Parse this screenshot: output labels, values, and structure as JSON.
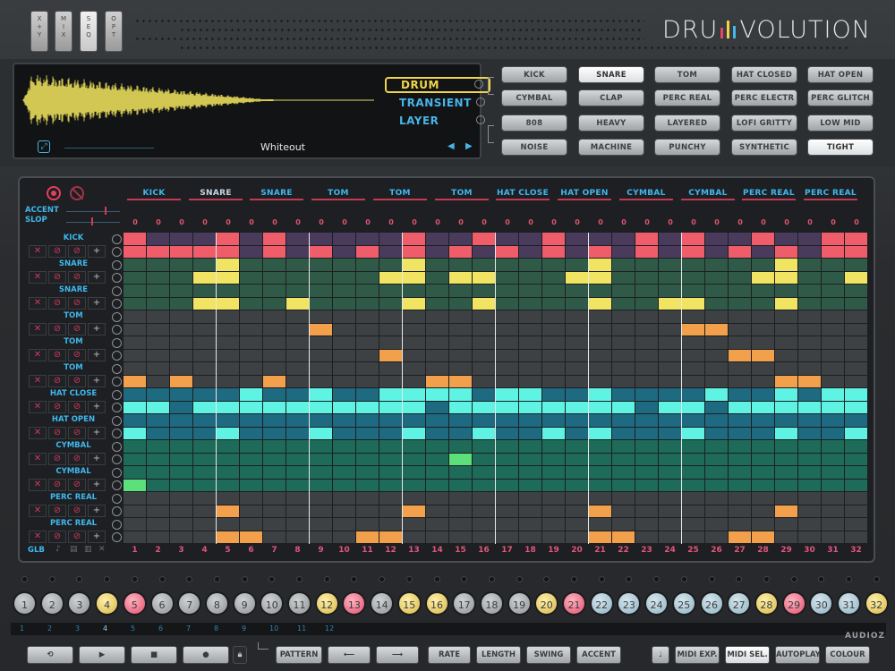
{
  "top_tabs": [
    {
      "l1": "X",
      "l2": "+",
      "l3": "Y"
    },
    {
      "l1": "M",
      "l2": "I",
      "l3": "X"
    },
    {
      "l1": "S",
      "l2": "E",
      "l3": "Q"
    },
    {
      "l1": "O",
      "l2": "P",
      "l3": "T"
    }
  ],
  "logo": {
    "left": "DRU",
    "right": "VOLUTION"
  },
  "sample_types": [
    "DRUM",
    "TRANSIENT",
    "LAYER"
  ],
  "preset_name": "Whiteout",
  "kit_buttons": [
    [
      "KICK",
      "SNARE",
      "TOM",
      "HAT CLOSED",
      "HAT OPEN"
    ],
    [
      "CYMBAL",
      "CLAP",
      "PERC REAL",
      "PERC ELECTR",
      "PERC GLITCH"
    ],
    [
      "808",
      "HEAVY",
      "LAYERED",
      "LOFI GRITTY",
      "LOW MID"
    ],
    [
      "NOISE",
      "MACHINE",
      "PUNCHY",
      "SYNTHETIC",
      "TIGHT"
    ]
  ],
  "seq": {
    "column_headers": [
      "KICK",
      "SNARE",
      "SNARE",
      "TOM",
      "TOM",
      "TOM",
      "HAT CLOSE",
      "HAT OPEN",
      "CYMBAL",
      "CYMBAL",
      "PERC REAL",
      "PERC REAL"
    ],
    "accent_label": "ACCENT",
    "slop_label": "SLOP",
    "glb_label": "GLB",
    "rows": [
      "KICK",
      "SNARE",
      "SNARE",
      "TOM",
      "TOM",
      "TOM",
      "HAT CLOSE",
      "HAT OPEN",
      "CYMBAL",
      "CYMBAL",
      "PERC REAL",
      "PERC REAL"
    ],
    "step_counts": [
      "0",
      "0",
      "0",
      "0",
      "0",
      "0",
      "0",
      "0",
      "0",
      "0",
      "0",
      "0",
      "0",
      "0",
      "0",
      "0",
      "0",
      "0",
      "0",
      "0",
      "0",
      "0",
      "0",
      "0",
      "0",
      "0",
      "0",
      "0",
      "0",
      "0",
      "0",
      "0"
    ],
    "steps": [
      "1",
      "2",
      "3",
      "4",
      "5",
      "6",
      "7",
      "8",
      "9",
      "10",
      "11",
      "12",
      "13",
      "14",
      "15",
      "16",
      "17",
      "18",
      "19",
      "20",
      "21",
      "22",
      "23",
      "24",
      "25",
      "26",
      "27",
      "28",
      "29",
      "30",
      "31",
      "32"
    ]
  },
  "pads": [
    "1",
    "2",
    "3",
    "4",
    "5",
    "6",
    "7",
    "8",
    "9",
    "10",
    "11",
    "12",
    "13",
    "14",
    "15",
    "16",
    "17",
    "18",
    "19",
    "20",
    "21",
    "22",
    "23",
    "24",
    "25",
    "26",
    "27",
    "28",
    "29",
    "30",
    "31",
    "32"
  ],
  "patterns": [
    "1",
    "2",
    "3",
    "4",
    "5",
    "6",
    "7",
    "8",
    "9",
    "10",
    "11",
    "12"
  ],
  "transport": {
    "pattern": "PATTERN",
    "rate": "RATE",
    "length": "LENGTH",
    "swing": "SWING",
    "accent": "ACCENT",
    "midi_exp": "MIDI EXP.",
    "midi_sel": "MIDI SEL.",
    "autoplay": "AUTOPLAY",
    "colour": "COLOUR"
  },
  "watermark": "AUDIOZ"
}
